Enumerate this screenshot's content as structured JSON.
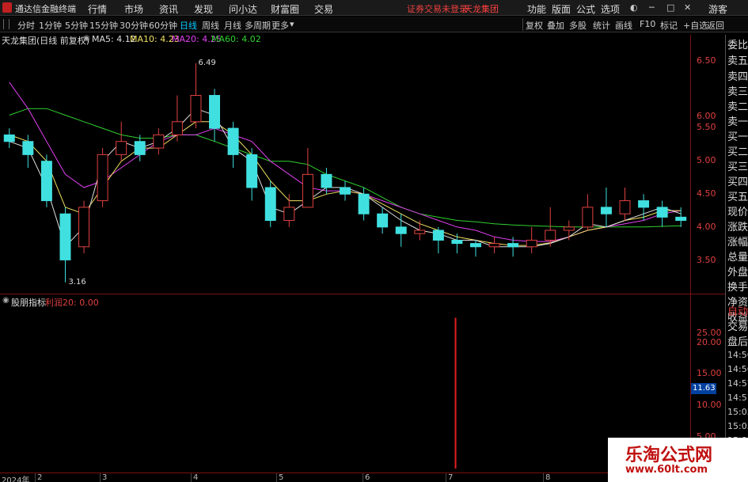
{
  "app": {
    "title": "通达信金融终端"
  },
  "menu": [
    "行情",
    "市场",
    "资讯",
    "发现",
    "问小达",
    "财富圈",
    "交易"
  ],
  "notice": {
    "trade": "证券交易未登录",
    "stock": "天龙集团"
  },
  "right_menu": [
    "功能",
    "版面",
    "公式",
    "选项"
  ],
  "guest": "游客",
  "periods": [
    "分时",
    "1分钟",
    "5分钟",
    "15分钟",
    "30分钟",
    "60分钟",
    "日线",
    "周线",
    "月线",
    "多周期",
    "更多"
  ],
  "active_period": "日线",
  "tools": [
    "复权",
    "叠加",
    "多股",
    "统计",
    "画线",
    "F10",
    "标记",
    "+自选",
    "返回"
  ],
  "main_info": {
    "name": "天龙集团(日线 前复权)",
    "ma5": "MA5: 4.12",
    "ma10": "MA10: 4.23",
    "ma20": "MA20: 4.25",
    "ma60": "MA60: 4.02"
  },
  "indicator": {
    "name": "股朋指标",
    "value": "利润20: 0.00",
    "current": "11.63"
  },
  "y_main": [
    "6.50",
    "6.00",
    "5.50",
    "5.00",
    "4.50",
    "4.00",
    "3.50"
  ],
  "y_sub": [
    "25.00",
    "20.00",
    "15.00",
    "10.00",
    "5.00"
  ],
  "x_labels": [
    "2024年",
    "2",
    "3",
    "4",
    "5",
    "6",
    "7",
    "8"
  ],
  "annotations": {
    "high": "6.49",
    "low": "3.16"
  },
  "right_panel": [
    "委比",
    "卖五",
    "卖四",
    "卖三",
    "卖二",
    "卖一",
    "买一",
    "买二",
    "买三",
    "买四",
    "买五",
    "现价",
    "涨跌",
    "涨幅",
    "总量",
    "外盘",
    "换手",
    "净资",
    "收益"
  ],
  "right_panel2": [
    "自动",
    "交易",
    "盘后"
  ],
  "right_times": [
    "14:56",
    "14:56",
    "14:57",
    "14:57",
    "15:05",
    "15:05",
    "15:05"
  ],
  "watermark": {
    "text": "乐淘公式网",
    "url": "www.60lt.com"
  },
  "colors": {
    "up": "#e04040",
    "down": "#40e0e0",
    "ma5": "#e0e0e0",
    "ma10": "#f0e060",
    "ma20": "#e040f0",
    "ma60": "#30d030"
  },
  "chart_data": {
    "type": "candlestick",
    "ylim": [
      3.0,
      6.8
    ],
    "ma5": [
      5.3,
      5.2,
      4.6,
      3.7,
      4.0,
      5.0,
      5.3,
      5.2,
      5.3,
      5.5,
      5.8,
      5.7,
      5.2,
      5.0,
      4.3,
      4.2,
      4.4,
      4.6,
      4.6,
      4.5,
      4.3,
      4.1,
      3.95,
      3.9,
      3.8,
      3.8,
      3.7,
      3.7,
      3.7,
      3.75,
      3.85,
      4.05,
      4.0,
      4.1,
      4.2,
      4.3,
      4.2
    ],
    "ma10": [
      5.4,
      5.3,
      5.0,
      4.3,
      4.2,
      4.6,
      5.0,
      5.2,
      5.2,
      5.4,
      5.6,
      5.6,
      5.4,
      5.1,
      4.7,
      4.4,
      4.4,
      4.5,
      4.55,
      4.5,
      4.35,
      4.2,
      4.05,
      3.95,
      3.85,
      3.8,
      3.75,
      3.72,
      3.72,
      3.76,
      3.85,
      3.95,
      4.0,
      4.1,
      4.15,
      4.25,
      4.25
    ],
    "ma20": [
      6.2,
      5.8,
      5.3,
      4.8,
      4.6,
      4.7,
      4.9,
      5.1,
      5.3,
      5.4,
      5.4,
      5.5,
      5.4,
      5.3,
      5.0,
      4.8,
      4.6,
      4.55,
      4.55,
      4.5,
      4.4,
      4.3,
      4.2,
      4.1,
      4.0,
      3.95,
      3.85,
      3.8,
      3.78,
      3.78,
      3.85,
      3.95,
      4.0,
      4.05,
      4.1,
      4.2,
      4.25
    ],
    "ma60": [
      5.7,
      5.8,
      5.8,
      5.7,
      5.6,
      5.5,
      5.4,
      5.35,
      5.35,
      5.4,
      5.4,
      5.3,
      5.2,
      5.1,
      5.0,
      5.0,
      4.95,
      4.8,
      4.7,
      4.6,
      4.45,
      4.3,
      4.2,
      4.15,
      4.1,
      4.08,
      4.05,
      4.03,
      4.02,
      4.01,
      4.0,
      4.0,
      4.0,
      4.0,
      4.0,
      4.01,
      4.02
    ],
    "candles": [
      [
        5.4,
        5.3,
        5.5,
        5.2
      ],
      [
        5.3,
        5.1,
        5.4,
        4.9
      ],
      [
        5.0,
        4.4,
        5.1,
        4.3
      ],
      [
        4.2,
        3.5,
        4.3,
        3.16
      ],
      [
        3.7,
        4.3,
        4.4,
        3.6
      ],
      [
        4.4,
        5.1,
        5.2,
        4.3
      ],
      [
        5.1,
        5.3,
        5.6,
        5.0
      ],
      [
        5.3,
        5.1,
        5.4,
        5.0
      ],
      [
        5.2,
        5.4,
        5.5,
        5.1
      ],
      [
        5.4,
        5.6,
        6.0,
        5.3
      ],
      [
        5.6,
        6.0,
        6.49,
        5.5
      ],
      [
        6.0,
        5.5,
        6.1,
        5.3
      ],
      [
        5.5,
        5.1,
        5.6,
        4.9
      ],
      [
        5.1,
        4.6,
        5.2,
        4.4
      ],
      [
        4.6,
        4.1,
        4.7,
        4.0
      ],
      [
        4.1,
        4.3,
        4.5,
        4.0
      ],
      [
        4.3,
        4.8,
        5.2,
        4.3
      ],
      [
        4.8,
        4.6,
        4.9,
        4.5
      ],
      [
        4.6,
        4.5,
        4.7,
        4.4
      ],
      [
        4.5,
        4.2,
        4.6,
        4.1
      ],
      [
        4.2,
        4.0,
        4.3,
        3.9
      ],
      [
        4.0,
        3.9,
        4.2,
        3.7
      ],
      [
        3.9,
        3.95,
        4.1,
        3.8
      ],
      [
        3.95,
        3.8,
        4.0,
        3.6
      ],
      [
        3.8,
        3.75,
        3.9,
        3.6
      ],
      [
        3.75,
        3.7,
        3.8,
        3.55
      ],
      [
        3.7,
        3.75,
        3.85,
        3.6
      ],
      [
        3.75,
        3.7,
        3.85,
        3.55
      ],
      [
        3.7,
        3.8,
        4.0,
        3.6
      ],
      [
        3.8,
        3.95,
        4.3,
        3.7
      ],
      [
        3.95,
        4.0,
        4.1,
        3.8
      ],
      [
        4.0,
        4.3,
        4.5,
        3.95
      ],
      [
        4.3,
        4.2,
        4.6,
        4.0
      ],
      [
        4.2,
        4.4,
        4.6,
        4.1
      ],
      [
        4.4,
        4.3,
        4.5,
        4.1
      ],
      [
        4.3,
        4.15,
        4.4,
        4.0
      ],
      [
        4.15,
        4.1,
        4.3,
        4.0
      ]
    ],
    "indicator_spike": {
      "index": 0.66,
      "value": 25.0
    }
  }
}
